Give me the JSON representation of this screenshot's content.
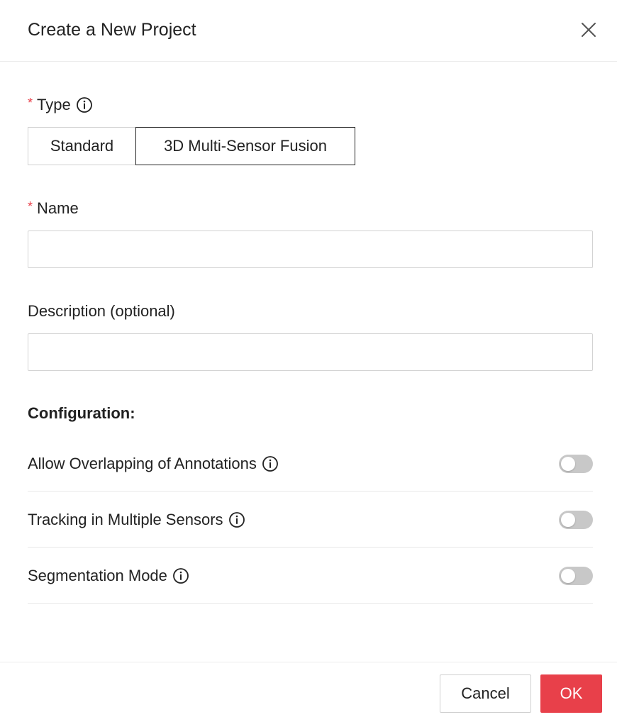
{
  "dialog": {
    "title": "Create a New Project",
    "close_icon": "close-icon"
  },
  "type_field": {
    "required_mark": "*",
    "label": "Type",
    "info_icon": "info-icon",
    "options": [
      "Standard",
      "3D Multi-Sensor Fusion"
    ],
    "selected": "3D Multi-Sensor Fusion"
  },
  "name_field": {
    "required_mark": "*",
    "label": "Name",
    "value": "",
    "placeholder": ""
  },
  "description_field": {
    "label": "Description (optional)",
    "value": "",
    "placeholder": ""
  },
  "configuration": {
    "title": "Configuration:",
    "items": [
      {
        "label": "Allow Overlapping of Annotations",
        "enabled": false,
        "info_icon": "info-icon"
      },
      {
        "label": "Tracking in Multiple Sensors",
        "enabled": false,
        "info_icon": "info-icon"
      },
      {
        "label": "Segmentation Mode",
        "enabled": false,
        "info_icon": "info-icon"
      }
    ]
  },
  "footer": {
    "cancel_label": "Cancel",
    "ok_label": "OK"
  },
  "colors": {
    "accent": "#e8404a",
    "toggle_off": "#c8c8c8",
    "text": "#222222",
    "border": "#d0d0d0"
  }
}
